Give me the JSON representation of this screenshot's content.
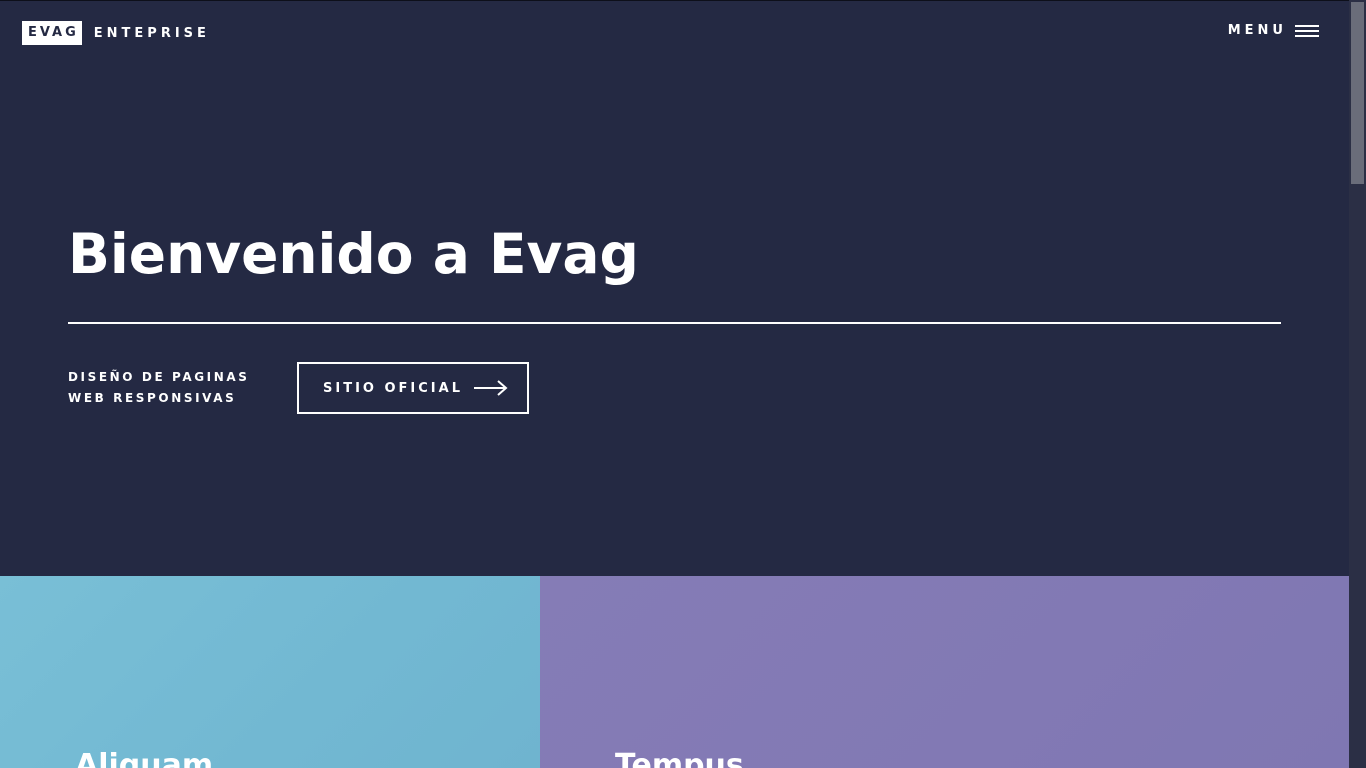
{
  "header": {
    "logo_mark": "EVAG",
    "logo_text": "ENTEPRISE",
    "menu_label": "MENU",
    "menu_icon": "hamburger-icon"
  },
  "banner": {
    "title": "Bienvenido a Evag",
    "subtitle": "DISEÑO DE PAGINAS WEB RESPONSIVAS",
    "button_label": "SITIO OFICIAL",
    "button_icon": "arrow-right-icon"
  },
  "tiles": [
    {
      "title": "Aliquam",
      "color": "#75bbd4"
    },
    {
      "title": "Tempus",
      "color": "#837ab5"
    }
  ],
  "colors": {
    "background": "#242943",
    "text": "#ffffff"
  }
}
